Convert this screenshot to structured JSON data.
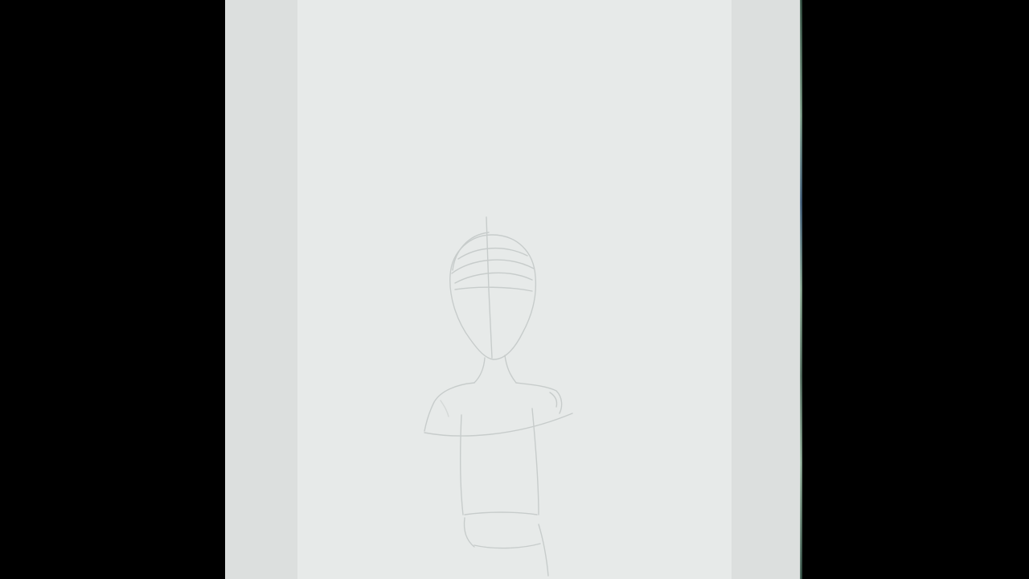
{
  "scene": {
    "subject": "pencil-sketch-of-figure",
    "colors": {
      "letterbox": "#000000",
      "frame": "#dcdfde",
      "canvas": "#e7eae9",
      "pencil": "#c9cdcc"
    }
  }
}
